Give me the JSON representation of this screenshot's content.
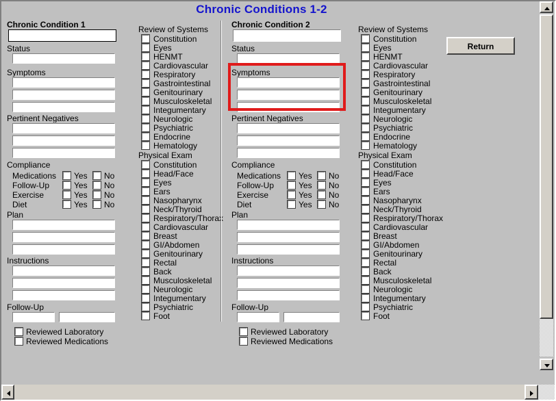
{
  "window": {
    "title": "Chronic Conditions 1-2",
    "title_color": "#1414cd",
    "background_color": "#c0c0c0"
  },
  "annotation": {
    "type": "red-rectangle-highlight",
    "color": "#e01b1b",
    "target": "Symptoms group of Chronic Condition 2"
  },
  "actions": {
    "return_label": "Return"
  },
  "panels": [
    {
      "id": "condition1",
      "heading": "Chronic Condition 1",
      "condition_value": "",
      "condition_focused": true,
      "status_label": "Status",
      "status_value": "",
      "symptoms_label": "Symptoms",
      "symptoms_values": [
        "",
        "",
        ""
      ],
      "pertinent_negatives_label": "Pertinent Negatives",
      "pertinent_negatives_values": [
        "",
        "",
        ""
      ],
      "compliance_label": "Compliance",
      "compliance_rows": [
        {
          "label": "Medications",
          "yes_label": "Yes",
          "no_label": "No",
          "yes": false,
          "no": false
        },
        {
          "label": "Follow-Up",
          "yes_label": "Yes",
          "no_label": "No",
          "yes": false,
          "no": false
        },
        {
          "label": "Exercise",
          "yes_label": "Yes",
          "no_label": "No",
          "yes": false,
          "no": false
        },
        {
          "label": "Diet",
          "yes_label": "Yes",
          "no_label": "No",
          "yes": false,
          "no": false
        }
      ],
      "plan_label": "Plan",
      "plan_values": [
        "",
        "",
        ""
      ],
      "instructions_label": "Instructions",
      "instructions_values": [
        "",
        "",
        ""
      ],
      "followup_label": "Follow-Up",
      "followup_values": [
        "",
        ""
      ],
      "review_checks": [
        {
          "label": "Reviewed Laboratory",
          "checked": false
        },
        {
          "label": "Reviewed Medications",
          "checked": false
        }
      ]
    },
    {
      "id": "condition2",
      "heading": "Chronic Condition 2",
      "condition_value": "",
      "condition_focused": false,
      "status_label": "Status",
      "status_value": "",
      "symptoms_label": "Symptoms",
      "symptoms_values": [
        "",
        "",
        ""
      ],
      "pertinent_negatives_label": "Pertinent Negatives",
      "pertinent_negatives_values": [
        "",
        "",
        ""
      ],
      "compliance_label": "Compliance",
      "compliance_rows": [
        {
          "label": "Medications",
          "yes_label": "Yes",
          "no_label": "No",
          "yes": false,
          "no": false
        },
        {
          "label": "Follow-Up",
          "yes_label": "Yes",
          "no_label": "No",
          "yes": false,
          "no": false
        },
        {
          "label": "Exercise",
          "yes_label": "Yes",
          "no_label": "No",
          "yes": false,
          "no": false
        },
        {
          "label": "Diet",
          "yes_label": "Yes",
          "no_label": "No",
          "yes": false,
          "no": false
        }
      ],
      "plan_label": "Plan",
      "plan_values": [
        "",
        "",
        ""
      ],
      "instructions_label": "Instructions",
      "instructions_values": [
        "",
        "",
        ""
      ],
      "followup_label": "Follow-Up",
      "followup_values": [
        "",
        ""
      ],
      "review_checks": [
        {
          "label": "Reviewed Laboratory",
          "checked": false
        },
        {
          "label": "Reviewed Medications",
          "checked": false
        }
      ]
    }
  ],
  "checklists": [
    {
      "id": "checklist1",
      "ros_label": "Review of Systems",
      "ros_items": [
        "Constitution",
        "Eyes",
        "HENMT",
        "Cardiovascular",
        "Respiratory",
        "Gastrointestinal",
        "Genitourinary",
        "Musculoskeletal",
        "Integumentary",
        "Neurologic",
        "Psychiatric",
        "Endocrine",
        "Hematology"
      ],
      "pe_label": "Physical Exam",
      "pe_items": [
        "Constitution",
        "Head/Face",
        "Eyes",
        "Ears",
        "Nasopharynx",
        "Neck/Thyroid",
        "Respiratory/Thorax",
        "Cardiovascular",
        "Breast",
        "GI/Abdomen",
        "Genitourinary",
        "Rectal",
        "Back",
        "Musculoskeletal",
        "Neurologic",
        "Integumentary",
        "Psychiatric",
        "Foot"
      ]
    },
    {
      "id": "checklist2",
      "ros_label": "Review of Systems",
      "ros_items": [
        "Constitution",
        "Eyes",
        "HENMT",
        "Cardiovascular",
        "Respiratory",
        "Gastrointestinal",
        "Genitourinary",
        "Musculoskeletal",
        "Integumentary",
        "Neurologic",
        "Psychiatric",
        "Endocrine",
        "Hematology"
      ],
      "pe_label": "Physical Exam",
      "pe_items": [
        "Constitution",
        "Head/Face",
        "Eyes",
        "Ears",
        "Nasopharynx",
        "Neck/Thyroid",
        "Respiratory/Thorax",
        "Cardiovascular",
        "Breast",
        "GI/Abdomen",
        "Genitourinary",
        "Rectal",
        "Back",
        "Musculoskeletal",
        "Neurologic",
        "Integumentary",
        "Psychiatric",
        "Foot"
      ]
    }
  ],
  "scrollbars": {
    "vertical": {
      "up_icon": "triangle-up",
      "down_icon": "triangle-down"
    },
    "horizontal": {
      "left_icon": "triangle-left",
      "right_icon": "triangle-right"
    }
  }
}
